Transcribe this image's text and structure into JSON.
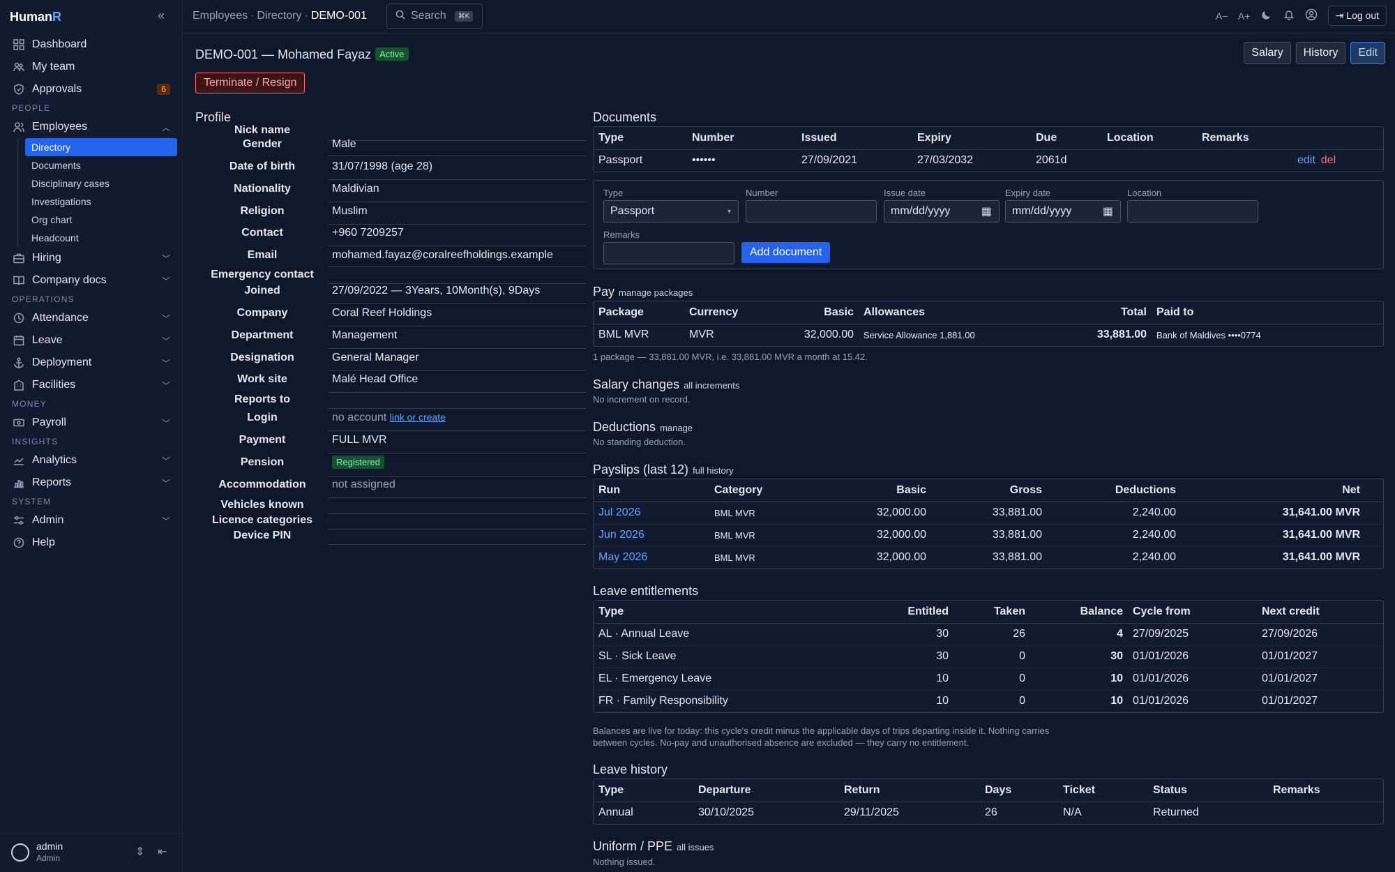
{
  "sidebar": {
    "brand_main": "Human",
    "brand_accent": "R",
    "items": {
      "dashboard": "Dashboard",
      "my_team": "My team",
      "approvals": "Approvals",
      "approvals_badge": "6",
      "people_label": "PEOPLE",
      "employees": "Employees",
      "directory": "Directory",
      "documents": "Documents",
      "disciplinary": "Disciplinary cases",
      "investigations": "Investigations",
      "org_chart": "Org chart",
      "headcount": "Headcount",
      "hiring": "Hiring",
      "company_docs": "Company docs",
      "operations_label": "OPERATIONS",
      "attendance": "Attendance",
      "leave": "Leave",
      "deployment": "Deployment",
      "facilities": "Facilities",
      "money_label": "MONEY",
      "payroll": "Payroll",
      "insights_label": "INSIGHTS",
      "analytics": "Analytics",
      "reports": "Reports",
      "system_label": "SYSTEM",
      "admin": "Admin",
      "help": "Help"
    },
    "user": {
      "name": "admin",
      "role": "Admin"
    }
  },
  "topbar": {
    "crumb1": "Employees",
    "crumb2": "Directory",
    "crumb3": "DEMO-001",
    "search": "Search",
    "search_kbd": "⌘K",
    "font_smaller": "A−",
    "font_larger": "A+",
    "logout": "Log out"
  },
  "employee": {
    "title": "DEMO-001 — Mohamed Fayaz",
    "status": "Active",
    "terminate": "Terminate / Resign",
    "actions": {
      "salary": "Salary",
      "history": "History",
      "edit": "Edit"
    }
  },
  "profile": {
    "heading": "Profile",
    "nick_name_l": "Nick name",
    "gender_l": "Gender",
    "gender": "Male",
    "dob_l": "Date of birth",
    "dob": "31/07/1998 (age 28)",
    "nationality_l": "Nationality",
    "nationality": "Maldivian",
    "religion_l": "Religion",
    "religion": "Muslim",
    "contact_l": "Contact",
    "contact": "+960 7209257",
    "email_l": "Email",
    "email": "mohamed.fayaz@coralreefholdings.example",
    "emergency_l": "Emergency contact",
    "joined_l": "Joined",
    "joined": "27/09/2022 — 3Years, 10Month(s), 9Days",
    "company_l": "Company",
    "company": "Coral Reef Holdings",
    "department_l": "Department",
    "department": "Management",
    "designation_l": "Designation",
    "designation": "General Manager",
    "work_site_l": "Work site",
    "work_site": "Malé Head Office",
    "reports_to_l": "Reports to",
    "login_l": "Login",
    "login": "no account",
    "login_link": "link or create",
    "payment_l": "Payment",
    "payment": "FULL MVR",
    "pension_l": "Pension",
    "pension": "Registered",
    "accommodation_l": "Accommodation",
    "accommodation": "not assigned",
    "vehicles_l": "Vehicles known",
    "licence_l": "Licence categories",
    "device_pin_l": "Device PIN"
  },
  "documents": {
    "heading": "Documents",
    "headers": [
      "Type",
      "Number",
      "Issued",
      "Expiry",
      "Due",
      "Location",
      "Remarks"
    ],
    "row": {
      "type": "Passport",
      "number": "••••••",
      "issued": "27/09/2021",
      "expiry": "27/03/2032",
      "due": "2061d",
      "edit": "edit",
      "del": "del"
    },
    "form": {
      "type_l": "Type",
      "type_v": "Passport",
      "number_l": "Number",
      "issue_l": "Issue date",
      "issue_ph": "mm/dd/yyyy",
      "expiry_l": "Expiry date",
      "expiry_ph": "mm/dd/yyyy",
      "location_l": "Location",
      "remarks_l": "Remarks",
      "add": "Add document"
    }
  },
  "pay": {
    "heading": "Pay",
    "link": "manage packages",
    "headers": [
      "Package",
      "Currency",
      "Basic",
      "Allowances",
      "Total",
      "Paid to"
    ],
    "row": {
      "package": "BML MVR",
      "currency": "MVR",
      "basic": "32,000.00",
      "allowances": "Service Allowance 1,881.00",
      "total": "33,881.00",
      "paid_to": "Bank of Maldives ••••0774"
    },
    "note": "1 package — 33,881.00 MVR, i.e. 33,881.00 MVR a month at 15.42."
  },
  "salary_changes": {
    "heading": "Salary changes",
    "link": "all increments",
    "note": "No increment on record."
  },
  "deductions": {
    "heading": "Deductions",
    "link": "manage",
    "note": "No standing deduction."
  },
  "payslips": {
    "heading": "Payslips (last 12)",
    "link": "full history",
    "headers": [
      "Run",
      "Category",
      "Basic",
      "Gross",
      "Deductions",
      "Net"
    ],
    "rows": [
      {
        "run": "Jul 2026",
        "category": "BML MVR",
        "basic": "32,000.00",
        "gross": "33,881.00",
        "deductions": "2,240.00",
        "net": "31,641.00 MVR"
      },
      {
        "run": "Jun 2026",
        "category": "BML MVR",
        "basic": "32,000.00",
        "gross": "33,881.00",
        "deductions": "2,240.00",
        "net": "31,641.00 MVR"
      },
      {
        "run": "May 2026",
        "category": "BML MVR",
        "basic": "32,000.00",
        "gross": "33,881.00",
        "deductions": "2,240.00",
        "net": "31,641.00 MVR"
      }
    ]
  },
  "leave_ent": {
    "heading": "Leave entitlements",
    "headers": [
      "Type",
      "Entitled",
      "Taken",
      "Balance",
      "Cycle from",
      "Next credit"
    ],
    "rows": [
      {
        "type": "AL · Annual Leave",
        "entitled": "30",
        "taken": "26",
        "balance": "4",
        "cycle": "27/09/2025",
        "next": "27/09/2026"
      },
      {
        "type": "SL · Sick Leave",
        "entitled": "30",
        "taken": "0",
        "balance": "30",
        "cycle": "01/01/2026",
        "next": "01/01/2027"
      },
      {
        "type": "EL · Emergency Leave",
        "entitled": "10",
        "taken": "0",
        "balance": "10",
        "cycle": "01/01/2026",
        "next": "01/01/2027"
      },
      {
        "type": "FR · Family Responsibility",
        "entitled": "10",
        "taken": "0",
        "balance": "10",
        "cycle": "01/01/2026",
        "next": "01/01/2027"
      }
    ],
    "note1": "Balances are live for today: this cycle's credit minus the applicable days of trips departing inside it. Nothing carries",
    "note2": "between cycles. No-pay and unauthorised absence are excluded — they carry no entitlement."
  },
  "leave_hist": {
    "heading": "Leave history",
    "headers": [
      "Type",
      "Departure",
      "Return",
      "Days",
      "Ticket",
      "Status",
      "Remarks"
    ],
    "row": {
      "type": "Annual",
      "departure": "30/10/2025",
      "return": "29/11/2025",
      "days": "26",
      "ticket": "N/A",
      "status": "Returned"
    }
  },
  "uniform": {
    "heading": "Uniform / PPE",
    "link": "all issues",
    "note": "Nothing issued."
  }
}
